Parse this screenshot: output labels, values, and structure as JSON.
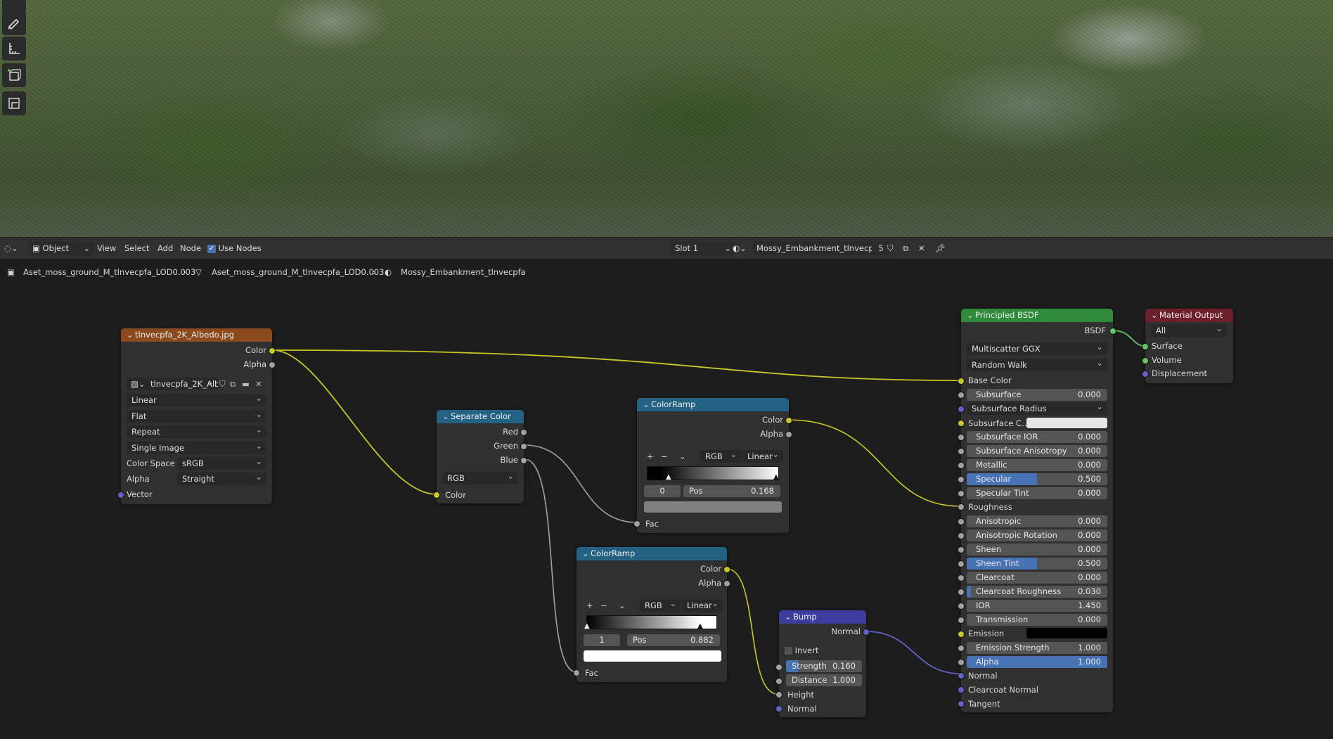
{
  "header": {
    "mode": "Object",
    "menus": [
      "View",
      "Select",
      "Add",
      "Node"
    ],
    "use_nodes_label": "Use Nodes",
    "use_nodes_checked": true,
    "slot": "Slot 1",
    "material_name": "Mossy_Embankment_tlnvecpfa",
    "user_count": "5"
  },
  "breadcrumb": {
    "object": "Aset_moss_ground_M_tlnvecpfa_LOD0.003",
    "mesh": "Aset_moss_ground_M_tlnvecpfa_LOD0.003",
    "material": "Mossy_Embankment_tlnvecpfa"
  },
  "image_node": {
    "title": "tlnvecpfa_2K_Albedo.jpg",
    "out_color": "Color",
    "out_alpha": "Alpha",
    "image_name": "tlnvecpfa_2K_Alb...",
    "interpolation": "Linear",
    "projection": "Flat",
    "extension": "Repeat",
    "source": "Single Image",
    "color_space_label": "Color Space",
    "color_space": "sRGB",
    "alpha_label": "Alpha",
    "alpha_mode": "Straight",
    "in_vector": "Vector",
    "header_color": "#8a4a1e"
  },
  "separate_node": {
    "title": "Separate Color",
    "out_red": "Red",
    "out_green": "Green",
    "out_blue": "Blue",
    "mode": "RGB",
    "in_color": "Color"
  },
  "ramp1": {
    "title": "ColorRamp",
    "out_color": "Color",
    "out_alpha": "Alpha",
    "color_mode": "RGB",
    "interpolation": "Linear",
    "index": "0",
    "pos_label": "Pos",
    "pos": "0.168",
    "in_fac": "Fac"
  },
  "ramp2": {
    "title": "ColorRamp",
    "out_color": "Color",
    "out_alpha": "Alpha",
    "color_mode": "RGB",
    "interpolation": "Linear",
    "index": "1",
    "pos_label": "Pos",
    "pos": "0.882",
    "in_fac": "Fac"
  },
  "bump": {
    "title": "Bump",
    "out_normal": "Normal",
    "invert_label": "Invert",
    "strength_label": "Strength",
    "strength": "0.160",
    "distance_label": "Distance",
    "distance": "1.000",
    "in_height": "Height",
    "in_normal": "Normal"
  },
  "bsdf": {
    "title": "Principled BSDF",
    "out_bsdf": "BSDF",
    "distribution": "Multiscatter GGX",
    "subsurface_method": "Random Walk",
    "base_color": "Base Color",
    "subsurface": {
      "label": "Subsurface",
      "value": "0.000"
    },
    "subsurface_radius": "Subsurface Radius",
    "subsurface_color": "Subsurface C...",
    "subsurface_ior": {
      "label": "Subsurface IOR",
      "value": "0.000"
    },
    "subsurface_anisotropy": {
      "label": "Subsurface Anisotropy",
      "value": "0.000"
    },
    "metallic": {
      "label": "Metallic",
      "value": "0.000"
    },
    "specular": {
      "label": "Specular",
      "value": "0.500"
    },
    "specular_tint": {
      "label": "Specular Tint",
      "value": "0.000"
    },
    "roughness": "Roughness",
    "anisotropic": {
      "label": "Anisotropic",
      "value": "0.000"
    },
    "anisotropic_rotation": {
      "label": "Anisotropic Rotation",
      "value": "0.000"
    },
    "sheen": {
      "label": "Sheen",
      "value": "0.000"
    },
    "sheen_tint": {
      "label": "Sheen Tint",
      "value": "0.500"
    },
    "clearcoat": {
      "label": "Clearcoat",
      "value": "0.000"
    },
    "clearcoat_roughness": {
      "label": "Clearcoat Roughness",
      "value": "0.030"
    },
    "ior": {
      "label": "IOR",
      "value": "1.450"
    },
    "transmission": {
      "label": "Transmission",
      "value": "0.000"
    },
    "emission": "Emission",
    "emission_strength": {
      "label": "Emission Strength",
      "value": "1.000"
    },
    "alpha": {
      "label": "Alpha",
      "value": "1.000"
    },
    "normal": "Normal",
    "clearcoat_normal": "Clearcoat Normal",
    "tangent": "Tangent"
  },
  "output_node": {
    "title": "Material Output",
    "target": "All",
    "in_surface": "Surface",
    "in_volume": "Volume",
    "in_displacement": "Displacement"
  },
  "colors": {
    "accent_blue": "#4772b3",
    "color_socket": "#c7c729",
    "float_socket": "#a1a1a1",
    "vector_socket": "#6363c7",
    "shader_socket": "#63c763"
  }
}
